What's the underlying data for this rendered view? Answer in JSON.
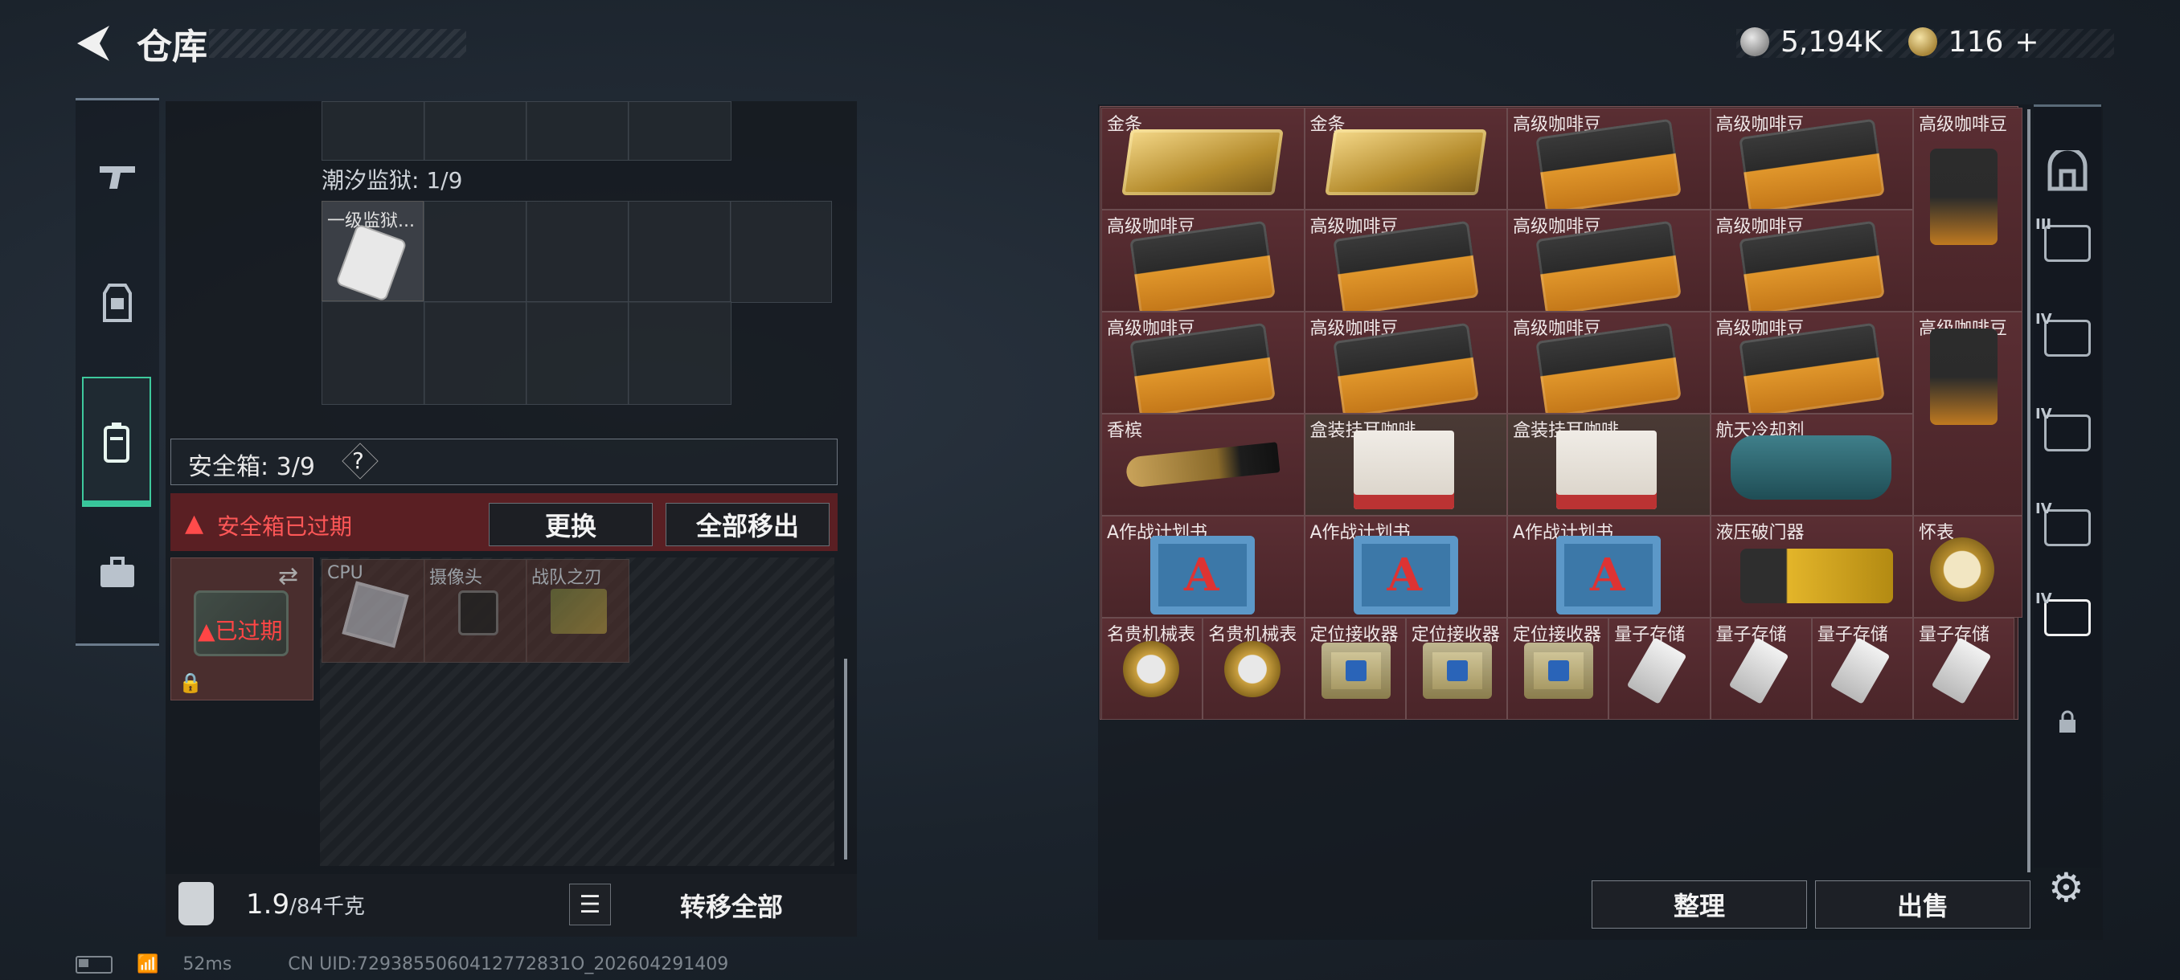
{
  "header": {
    "title": "仓库",
    "currency": {
      "silver": "5,194K",
      "gold": "116",
      "add": "+"
    }
  },
  "left_nav": {
    "items": [
      "gun-icon",
      "vest-icon",
      "backpack-icon",
      "case-icon"
    ],
    "active": 2
  },
  "prison": {
    "label": "潮汐监狱: 1/9",
    "item_label": "一级监狱..."
  },
  "safebox": {
    "label": "安全箱: 3/9",
    "help": "?",
    "warning": "安全箱已过期",
    "expired": "已过期",
    "replace": "更换",
    "move_all": "全部移出",
    "items": [
      {
        "label": "CPU"
      },
      {
        "label": "摄像头"
      },
      {
        "label": "战队之刃"
      }
    ]
  },
  "weight": {
    "value": "1.9",
    "max": "/84千克"
  },
  "transfer_all": "转移全部",
  "stash": {
    "rows": [
      [
        {
          "label": "金条",
          "pic": "gold-bar",
          "span": 1
        },
        {
          "label": "金条",
          "pic": "gold-bar",
          "span": 1
        },
        {
          "label": "高级咖啡豆",
          "pic": "coffee",
          "span": 1
        },
        {
          "label": "高级咖啡豆",
          "pic": "coffee",
          "span": 1
        },
        {
          "label": "高级咖啡豆",
          "pic": "coffee-tall",
          "span": 1
        }
      ],
      [
        {
          "label": "高级咖啡豆",
          "pic": "coffee"
        },
        {
          "label": "高级咖啡豆",
          "pic": "coffee"
        },
        {
          "label": "高级咖啡豆",
          "pic": "coffee"
        },
        {
          "label": "高级咖啡豆",
          "pic": "coffee"
        }
      ],
      [
        {
          "label": "高级咖啡豆",
          "pic": "coffee"
        },
        {
          "label": "高级咖啡豆",
          "pic": "coffee"
        },
        {
          "label": "高级咖啡豆",
          "pic": "coffee"
        },
        {
          "label": "高级咖啡豆",
          "pic": "coffee"
        },
        {
          "label": "高级咖啡豆",
          "pic": "coffee-tall2"
        }
      ],
      [
        {
          "label": "香槟",
          "pic": "bottle"
        },
        {
          "label": "盒装挂耳咖啡",
          "pic": "box-coffee"
        },
        {
          "label": "盒装挂耳咖啡",
          "pic": "box-coffee"
        },
        {
          "label": "航天冷却剂",
          "pic": "coolant"
        }
      ],
      [
        {
          "label": "A作战计划书",
          "pic": "plan-book"
        },
        {
          "label": "A作战计划书",
          "pic": "plan-book"
        },
        {
          "label": "A作战计划书",
          "pic": "plan-book"
        },
        {
          "label": "液压破门器",
          "pic": "breacher"
        },
        {
          "label": "怀表",
          "pic": "pocket-watch"
        }
      ],
      [
        {
          "label": "名贵机械表",
          "pic": "watch"
        },
        {
          "label": "名贵机械表",
          "pic": "watch"
        },
        {
          "label": "定位接收器",
          "pic": "receiver"
        },
        {
          "label": "定位接收器",
          "pic": "receiver"
        },
        {
          "label": "定位接收器",
          "pic": "receiver"
        },
        {
          "label": "量子存储",
          "pic": "quantum"
        },
        {
          "label": "量子存储",
          "pic": "quantum"
        },
        {
          "label": "量子存储",
          "pic": "quantum"
        },
        {
          "label": "量子存储",
          "pic": "quantum"
        }
      ]
    ]
  },
  "right_nav": {
    "tags": [
      "",
      "III",
      "IV",
      "IV",
      "IV",
      "IV",
      ""
    ],
    "active": 5
  },
  "actions": {
    "sort": "整理",
    "sell": "出售"
  },
  "status": {
    "ping": "52ms",
    "uid": "CN UID:7293855060412772831O_202604291409"
  },
  "colors": {
    "accent": "#3ec99d",
    "warning": "#ff5757",
    "stash_cell": "#5a2e33"
  }
}
